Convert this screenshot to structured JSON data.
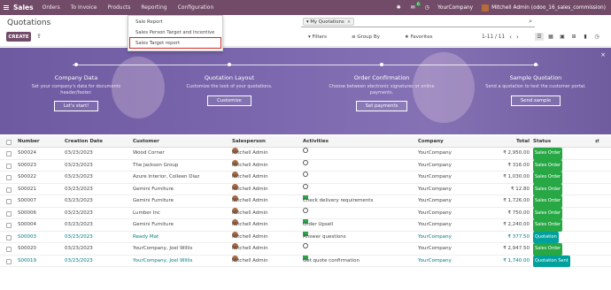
{
  "navbar": {
    "brand": "Sales",
    "menu": [
      "Orders",
      "To Invoice",
      "Products",
      "Reporting",
      "Configuration"
    ],
    "chat_badge": "6",
    "company": "YourCompany",
    "user": "Mitchell Admin (odoo_16_sales_commission)"
  },
  "control": {
    "title": "Quotations",
    "create_label": "CREATE",
    "facet_label": "My Quotations",
    "filters_label": "Filters",
    "groupby_label": "Group By",
    "favorites_label": "Favorites",
    "pager": "1-11 / 11"
  },
  "dropdown": {
    "items": [
      "Sale Report",
      "Sales Person Target and Incentive",
      "Sales Target report"
    ]
  },
  "banner": {
    "steps": [
      {
        "title": "Company Data",
        "desc": "Set your company's data for documents header/footer.",
        "button": "Let's start!"
      },
      {
        "title": "Quotation Layout",
        "desc": "Customize the look of your quotations.",
        "button": "Customize"
      },
      {
        "title": "Order Confirmation",
        "desc": "Choose between electronic signatures or online payments.",
        "button": "Set payments"
      },
      {
        "title": "Sample Quotation",
        "desc": "Send a quotation to test the customer portal.",
        "button": "Send sample"
      }
    ]
  },
  "table": {
    "headers": {
      "number": "Number",
      "creation_date": "Creation Date",
      "customer": "Customer",
      "salesperson": "Salesperson",
      "activities": "Activities",
      "company": "Company",
      "total": "Total",
      "status": "Status"
    },
    "rows": [
      {
        "number": "S00024",
        "date": "03/23/2023",
        "customer": "Wood Corner",
        "salesperson": "Mitchell Admin",
        "activity": "",
        "company": "YourCompany",
        "total": "₹ 2,950.00",
        "status": "Sales Order",
        "highlight": false
      },
      {
        "number": "S00023",
        "date": "03/23/2023",
        "customer": "The Jackson Group",
        "salesperson": "Mitchell Admin",
        "activity": "",
        "company": "YourCompany",
        "total": "₹ 316.00",
        "status": "Sales Order",
        "highlight": false
      },
      {
        "number": "S00022",
        "date": "03/23/2023",
        "customer": "Azure Interior, Colleen Diaz",
        "salesperson": "Mitchell Admin",
        "activity": "",
        "company": "YourCompany",
        "total": "₹ 1,030.00",
        "status": "Sales Order",
        "highlight": false
      },
      {
        "number": "S00021",
        "date": "03/23/2023",
        "customer": "Gemini Furniture",
        "salesperson": "Mitchell Admin",
        "activity": "",
        "company": "YourCompany",
        "total": "₹ 12.80",
        "status": "Sales Order",
        "highlight": false
      },
      {
        "number": "S00007",
        "date": "03/23/2023",
        "customer": "Gemini Furniture",
        "salesperson": "Mitchell Admin",
        "activity": "Check delivery requirements",
        "company": "YourCompany",
        "total": "₹ 1,726.00",
        "status": "Sales Order",
        "highlight": false
      },
      {
        "number": "S00006",
        "date": "03/23/2023",
        "customer": "Lumber Inc",
        "salesperson": "Mitchell Admin",
        "activity": "",
        "company": "YourCompany",
        "total": "₹ 750.00",
        "status": "Sales Order",
        "highlight": false
      },
      {
        "number": "S00004",
        "date": "03/23/2023",
        "customer": "Gemini Furniture",
        "salesperson": "Mitchell Admin",
        "activity": "Order Upsell",
        "company": "YourCompany",
        "total": "₹ 2,240.00",
        "status": "Sales Order",
        "highlight": false
      },
      {
        "number": "S00003",
        "date": "03/23/2023",
        "customer": "Ready Mat",
        "salesperson": "Mitchell Admin",
        "activity": "Answer questions",
        "company": "YourCompany",
        "total": "₹ 377.50",
        "status": "Quotation",
        "highlight": true
      },
      {
        "number": "S00020",
        "date": "03/23/2023",
        "customer": "YourCompany, Joel Willis",
        "salesperson": "Mitchell Admin",
        "activity": "",
        "company": "YourCompany",
        "total": "₹ 2,947.50",
        "status": "Sales Order",
        "highlight": false
      },
      {
        "number": "S00019",
        "date": "03/23/2023",
        "customer": "YourCompany, Joel Willis",
        "salesperson": "Mitchell Admin",
        "activity": "Get quote confirmation",
        "company": "YourCompany",
        "total": "₹ 1,740.00",
        "status": "Quotation Sent",
        "highlight": true
      }
    ]
  },
  "colors": {
    "brand": "#714b67",
    "banner": "#7a66ad",
    "status_green": "#28a745",
    "status_teal": "#00a09d",
    "link_teal": "#017e84",
    "highlight_box": "#d62626"
  }
}
